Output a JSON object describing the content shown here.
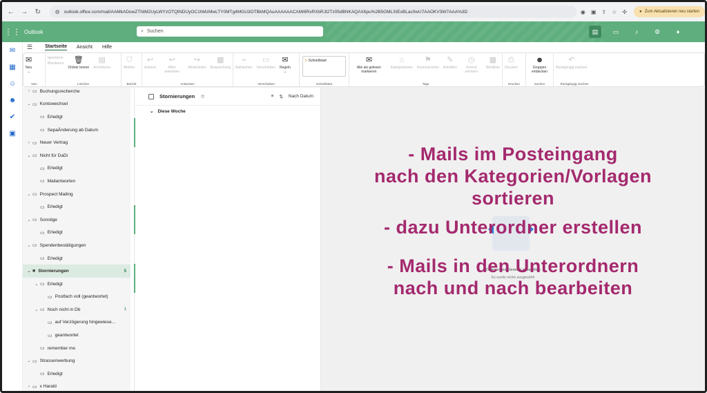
{
  "browser": {
    "url": "outlook.office.com/mail/AAMkADowZTNiM2UyLWYzOTQtNDUyOC1hMzMwLTY0MTg4MGU3OTBkMQAuAAAAAACAMI6RxRXbRJt2Tz05dBNKAQAX6pu%2B5GMLSIExBLac0wU7AAOKV3W7AAA%3D",
    "update_label": "Zum Aktualisieren neu starten"
  },
  "header": {
    "app_name": "Outlook",
    "search_placeholder": "Suchen"
  },
  "ribbon": {
    "tabs": [
      "Startseite",
      "Ansicht",
      "Hilfe"
    ],
    "groups": {
      "neu": {
        "label": "Neu",
        "buttons": [
          "Neu"
        ]
      },
      "loeschen": {
        "label": "Löschen",
        "small": [
          "Ignorieren",
          "Blockieren"
        ],
        "buttons": [
          "Ordner leeren",
          "Archivieren"
        ]
      },
      "bericht": {
        "label": "Bericht",
        "buttons": [
          "Melden"
        ]
      },
      "antworten": {
        "label": "Antworten",
        "buttons": [
          "Antwort",
          "Allen antworten",
          "Weiterleiten",
          "Besprechung"
        ]
      },
      "verschieben": {
        "label": "Verschieben",
        "buttons": [
          "Aufräumen",
          "Verschieben",
          "Regeln"
        ]
      },
      "schnellstart": {
        "label": "Schnellstart",
        "field": "Schnellstart"
      },
      "tags": {
        "label": "Tags",
        "buttons": [
          "Alle als gelesen markieren",
          "Kategorisieren",
          "Kennzeichnen",
          "Anheften",
          "Erneut erinnern",
          "Richtlinie"
        ]
      },
      "drucken": {
        "label": "Drucken",
        "buttons": [
          "Drucken"
        ]
      },
      "suchen": {
        "label": "Suchen",
        "buttons": [
          "Gruppen entdecken"
        ]
      },
      "rueck": {
        "label": "Rückgängig machen",
        "buttons": [
          "Rückgängig machen"
        ]
      }
    }
  },
  "folders": [
    {
      "label": "Buchungsrecherche",
      "indent": 1,
      "chev": ">",
      "count": ""
    },
    {
      "label": "Kontowechsel",
      "indent": 1,
      "chev": "v",
      "count": ""
    },
    {
      "label": "Erledigt",
      "indent": 2,
      "chev": "",
      "count": ""
    },
    {
      "label": "SepaÄnderung ab Datum",
      "indent": 2,
      "chev": "",
      "count": ""
    },
    {
      "label": "Neuer Vertrag",
      "indent": 1,
      "chev": ">",
      "count": ""
    },
    {
      "label": "Nicht für DaDi",
      "indent": 1,
      "chev": "v",
      "count": ""
    },
    {
      "label": "Erledigt",
      "indent": 2,
      "chev": "",
      "count": ""
    },
    {
      "label": "Mailantworten",
      "indent": 2,
      "chev": "",
      "count": ""
    },
    {
      "label": "Prospect Mailing",
      "indent": 1,
      "chev": "v",
      "count": ""
    },
    {
      "label": "Erledigt",
      "indent": 2,
      "chev": "",
      "count": ""
    },
    {
      "label": "Sonstige",
      "indent": 1,
      "chev": "v",
      "count": ""
    },
    {
      "label": "Erledigt",
      "indent": 2,
      "chev": "",
      "count": ""
    },
    {
      "label": "Spendenbestätigungen",
      "indent": 1,
      "chev": "v",
      "count": ""
    },
    {
      "label": "Erledigt",
      "indent": 2,
      "chev": "",
      "count": ""
    },
    {
      "label": "Stornierungen",
      "indent": 1,
      "chev": "v",
      "count": "5",
      "selected": true
    },
    {
      "label": "Erledigt",
      "indent": 2,
      "chev": "v",
      "count": ""
    },
    {
      "label": "Postfach voll (geantwortet)",
      "indent": 3,
      "chev": "",
      "count": ""
    },
    {
      "label": "Noch nicht in Db",
      "indent": 2,
      "chev": "v",
      "count": "1"
    },
    {
      "label": "auf Verzögerung hingewiese...",
      "indent": 3,
      "chev": "",
      "count": ""
    },
    {
      "label": "geantwortet",
      "indent": 3,
      "chev": "",
      "count": ""
    },
    {
      "label": "remember me",
      "indent": 2,
      "chev": "",
      "count": ""
    },
    {
      "label": "Strassenwerbung",
      "indent": 1,
      "chev": "v",
      "count": ""
    },
    {
      "label": "Erledigt",
      "indent": 2,
      "chev": "",
      "count": ""
    },
    {
      "label": "x Harald",
      "indent": 1,
      "chev": ">",
      "count": ""
    }
  ],
  "message_list": {
    "title": "Stornierungen",
    "sort_label": "Nach Datum",
    "section": "Diese Woche"
  },
  "reading_pane": {
    "empty_text": "Zu lesendes Element auswählen",
    "empty_sub": "Es wurde nichts ausgewählt"
  },
  "overlay": {
    "lines1": [
      "- Mails im Posteingang",
      "nach den Kategorien/Vorlagen",
      "sortieren"
    ],
    "lines2": [
      "- dazu Unterordner erstellen"
    ],
    "lines3": [
      "- Mails in den Unterordnern",
      "nach und nach bearbeiten"
    ]
  },
  "colors": {
    "header_green": "#5fae7e",
    "overlay_text": "#a4296e",
    "selected_folder": "#dcebe2"
  }
}
